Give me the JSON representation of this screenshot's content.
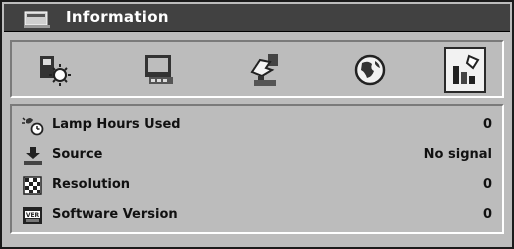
{
  "window": {
    "title": "Information",
    "title_icon": "information-menu-icon"
  },
  "tabs": [
    {
      "name": "image-settings",
      "icon": "image-settings-icon",
      "selected": false
    },
    {
      "name": "display-settings",
      "icon": "display-settings-icon",
      "selected": false
    },
    {
      "name": "setup",
      "icon": "setup-hand-icon",
      "selected": false
    },
    {
      "name": "language",
      "icon": "globe-icon",
      "selected": false
    },
    {
      "name": "information",
      "icon": "information-bars-icon",
      "selected": true
    }
  ],
  "info_rows": [
    {
      "label": "Lamp Hours Used",
      "value": "0",
      "icon": "lamp-hours-icon"
    },
    {
      "label": "Source",
      "value": "No signal",
      "icon": "source-icon"
    },
    {
      "label": "Resolution",
      "value": "0",
      "icon": "resolution-icon"
    },
    {
      "label": "Software Version",
      "value": "0",
      "icon": "software-version-icon"
    }
  ],
  "colors": {
    "title_bar": "#1f1f1f",
    "panel": "#d4d4d4",
    "text": "#111111"
  }
}
